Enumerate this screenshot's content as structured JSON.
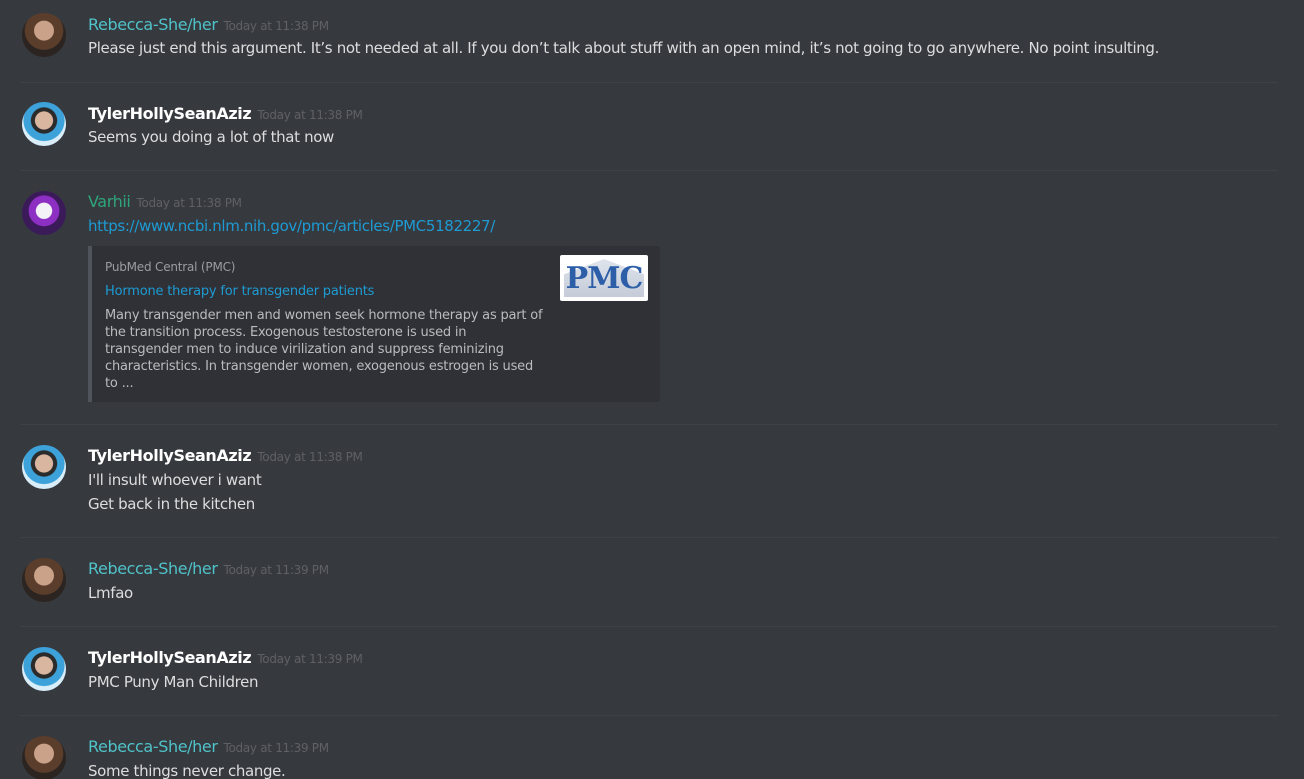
{
  "messages": [
    {
      "author": "Rebecca-She/her",
      "timestamp": "Today at 11:38 PM",
      "lines": [
        "Please just end this argument. It’s not needed at all. If you don’t talk about stuff with an open mind, it’s not going to go anywhere. No point insulting."
      ]
    },
    {
      "author": "TylerHollySeanAziz",
      "timestamp": "Today at 11:38 PM",
      "lines": [
        "Seems you doing a lot of that now"
      ]
    },
    {
      "author": "Varhii",
      "timestamp": "Today at 11:38 PM",
      "link": "https://www.ncbi.nlm.nih.gov/pmc/articles/PMC5182227/",
      "embed": {
        "provider": "PubMed Central (PMC)",
        "title": "Hormone therapy for transgender patients",
        "description": "Many transgender men and women seek hormone therapy as part of the transition process. Exogenous testosterone is used in transgender men to induce virilization and suppress feminizing characteristics. In transgender women, exogenous estrogen is used to ...",
        "thumbnail_text": "PMC"
      }
    },
    {
      "author": "TylerHollySeanAziz",
      "timestamp": "Today at 11:38 PM",
      "lines": [
        "I'll insult whoever i want",
        "Get back in the kitchen"
      ]
    },
    {
      "author": "Rebecca-She/her",
      "timestamp": "Today at 11:39 PM",
      "lines": [
        "Lmfao"
      ]
    },
    {
      "author": "TylerHollySeanAziz",
      "timestamp": "Today at 11:39 PM",
      "lines": [
        "PMC Puny Man Children"
      ]
    },
    {
      "author": "Rebecca-She/her",
      "timestamp": "Today at 11:39 PM",
      "lines": [
        "Some things never change."
      ]
    }
  ],
  "colors": {
    "background": "#36393e",
    "rebecca_name": "#4fc3c9",
    "tyler_name": "#ffffff",
    "varhii_name": "#2ea57a",
    "link": "#1e9bd4"
  }
}
